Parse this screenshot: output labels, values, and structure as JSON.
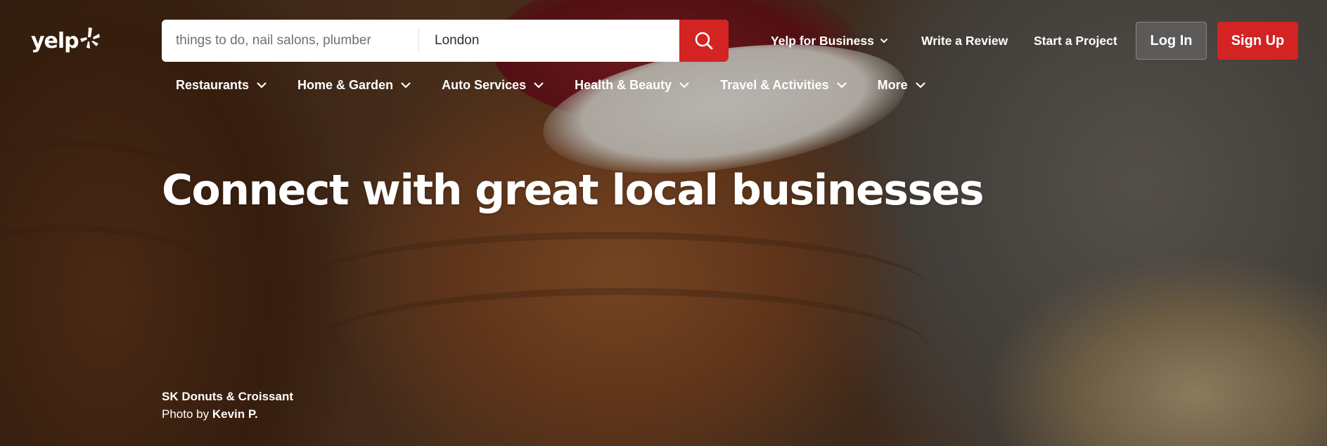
{
  "brand": {
    "logo_text": "yelp",
    "accent_color": "#d32323"
  },
  "search": {
    "find_placeholder": "things to do, nail salons, plumber",
    "near_value": "London",
    "submit_icon": "search-icon"
  },
  "header": {
    "business_label": "Yelp for Business",
    "write_review_label": "Write a Review",
    "start_project_label": "Start a Project",
    "login_label": "Log In",
    "signup_label": "Sign Up"
  },
  "categories": [
    {
      "label": "Restaurants"
    },
    {
      "label": "Home & Garden"
    },
    {
      "label": "Auto Services"
    },
    {
      "label": "Health & Beauty"
    },
    {
      "label": "Travel & Activities"
    },
    {
      "label": "More"
    }
  ],
  "hero": {
    "headline": "Connect with great local businesses",
    "business_name": "SK Donuts & Croissant",
    "photo_by_prefix": "Photo by",
    "photographer": "Kevin P."
  }
}
